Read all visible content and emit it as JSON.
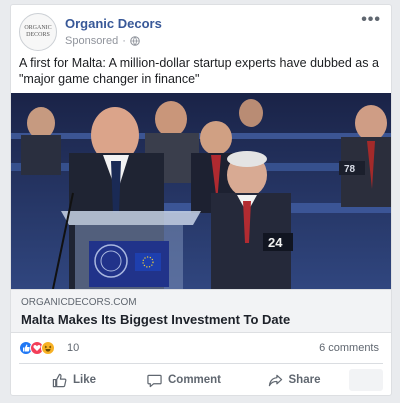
{
  "post": {
    "page_name": "Organic Decors",
    "sponsored_label": "Sponsored",
    "avatar_text": "ORGANIC DECORS",
    "more_label": "•••",
    "body_text": "A first for Malta: A million-dollar startup experts have dubbed as a \"major game changer in finance\"",
    "image": {
      "seat_number_1": "78",
      "seat_number_2": "24"
    },
    "link": {
      "domain": "ORGANICDECORS.COM",
      "headline": "Malta Makes Its Biggest Investment To Date"
    },
    "reactions": {
      "count": "10",
      "comments": "6 comments",
      "types": [
        "like",
        "love",
        "haha"
      ]
    },
    "actions": {
      "like": "Like",
      "comment": "Comment",
      "share": "Share"
    }
  },
  "colors": {
    "page_name": "#385898",
    "background": "#e9ebee",
    "like_blue": "#2078f4",
    "love_red": "#f33e58",
    "haha_yellow": "#f7b125"
  }
}
